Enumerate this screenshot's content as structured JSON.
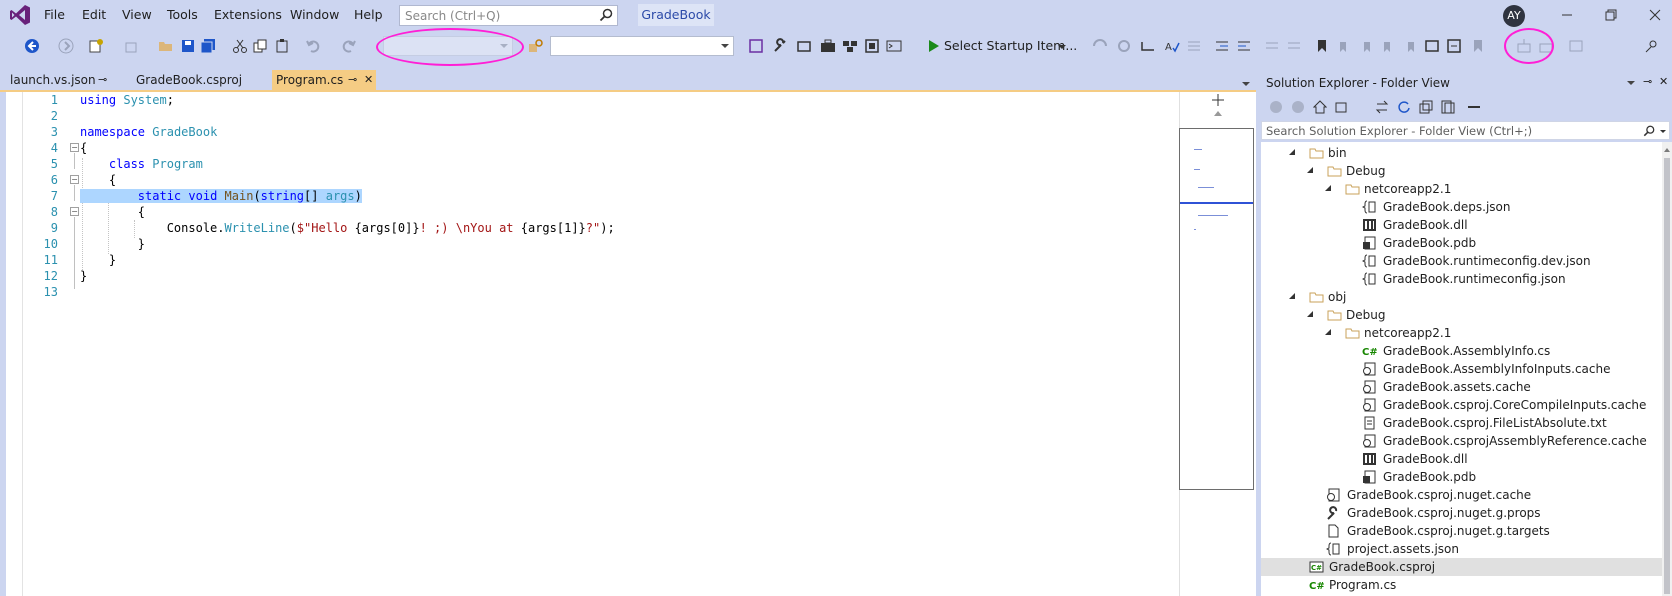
{
  "menu": {
    "items": [
      "File",
      "Edit",
      "View",
      "Tools",
      "Extensions",
      "Window",
      "Help"
    ]
  },
  "search": {
    "placeholder": "Search (Ctrl+Q)"
  },
  "solution_name": "GradeBook",
  "user": {
    "initials": "AY"
  },
  "toolbar": {
    "start_label": "Select Startup Item...",
    "icons": [
      "back-icon",
      "forward-icon",
      "new-item-icon",
      "add-item-icon",
      "open-folder-icon",
      "save-icon",
      "save-all-icon",
      "cut-icon",
      "copy-icon",
      "paste-icon",
      "undo-icon",
      "redo-icon",
      "find-icon",
      "start-icon",
      "bookmark-icon"
    ]
  },
  "tabs": [
    {
      "label": "launch.vs.json",
      "pinned": true,
      "active": false
    },
    {
      "label": "GradeBook.csproj",
      "pinned": false,
      "active": false
    },
    {
      "label": "Program.cs",
      "pinned": true,
      "active": true
    }
  ],
  "editor": {
    "line_numbers": [
      "1",
      "2",
      "3",
      "4",
      "5",
      "6",
      "7",
      "8",
      "9",
      "10",
      "11",
      "12",
      "13"
    ],
    "lines": [
      {
        "kw": "using",
        "rest": " ",
        "ty": "System",
        ";": ";"
      },
      {},
      {
        "kw": "namespace",
        "ty": "GradeBook"
      },
      {
        "text": "{"
      },
      {
        "kw": "class",
        "ty": "Program"
      },
      {
        "text": "{"
      },
      {
        "kw1": "static",
        "kw2": "void",
        "mt": "Main",
        "kw3": "string",
        "ty": "args"
      },
      {
        "text": "{"
      },
      {
        "obj": "Console",
        "mt": "WriteLine",
        "str": "$\"Hello {args[0]}! ;) \\nYou at {args[1]}?\""
      },
      {
        "text": "}"
      },
      {
        "text": "}"
      },
      {
        "text": "}"
      },
      {}
    ],
    "text": {
      "l1_kw": "using",
      "l1_ty": "System",
      "l1_end": ";",
      "l3_kw": "namespace",
      "l3_ty": "GradeBook",
      "brace_open": "{",
      "brace_close": "}",
      "l5_kw": "class",
      "l5_ty": "Program",
      "l7_kw1": "static",
      "l7_kw2": "void",
      "l7_mt": "Main",
      "l7_p1": "(",
      "l7_kw3": "string",
      "l7_p2": "[] ",
      "l7_ty": "args",
      "l7_p3": ")",
      "l9_obj": "Console.",
      "l9_mt": "WriteLine",
      "l9_p1": "(",
      "l9_str1": "$\"Hello ",
      "l9_i1": "{args[0]}",
      "l9_str2": "! ;) ",
      "l9_esc": "\\n",
      "l9_str3": "You at ",
      "l9_i2": "{args[1]}",
      "l9_str4": "?\"",
      "l9_end": ");"
    }
  },
  "solution_explorer": {
    "title": "Solution Explorer - Folder View",
    "search_placeholder": "Search Solution Explorer - Folder View (Ctrl+;)",
    "tree": [
      {
        "label": "bin",
        "type": "folder"
      },
      {
        "label": "Debug",
        "type": "folder"
      },
      {
        "label": "netcoreapp2.1",
        "type": "folder"
      },
      {
        "label": "GradeBook.deps.json",
        "type": "json"
      },
      {
        "label": "GradeBook.dll",
        "type": "dll"
      },
      {
        "label": "GradeBook.pdb",
        "type": "pdb"
      },
      {
        "label": "GradeBook.runtimeconfig.dev.json",
        "type": "json"
      },
      {
        "label": "GradeBook.runtimeconfig.json",
        "type": "json"
      },
      {
        "label": "obj",
        "type": "folder"
      },
      {
        "label": "Debug",
        "type": "folder"
      },
      {
        "label": "netcoreapp2.1",
        "type": "folder"
      },
      {
        "label": "GradeBook.AssemblyInfo.cs",
        "type": "cs"
      },
      {
        "label": "GradeBook.AssemblyInfoInputs.cache",
        "type": "cache"
      },
      {
        "label": "GradeBook.assets.cache",
        "type": "cache"
      },
      {
        "label": "GradeBook.csproj.CoreCompileInputs.cache",
        "type": "cache"
      },
      {
        "label": "GradeBook.csproj.FileListAbsolute.txt",
        "type": "txt"
      },
      {
        "label": "GradeBook.csprojAssemblyReference.cache",
        "type": "cache"
      },
      {
        "label": "GradeBook.dll",
        "type": "dll"
      },
      {
        "label": "GradeBook.pdb",
        "type": "pdb"
      },
      {
        "label": "GradeBook.csproj.nuget.cache",
        "type": "cache"
      },
      {
        "label": "GradeBook.csproj.nuget.g.props",
        "type": "props"
      },
      {
        "label": "GradeBook.csproj.nuget.g.targets",
        "type": "file"
      },
      {
        "label": "project.assets.json",
        "type": "json"
      },
      {
        "label": "GradeBook.csproj",
        "type": "csproj",
        "selected": true
      },
      {
        "label": "Program.cs",
        "type": "cs"
      }
    ]
  },
  "colors": {
    "chrome": "#ccd5f0",
    "active_tab": "#f5cc84",
    "annotation": "#ff1fd6",
    "keyword": "#0000ff",
    "type": "#2b91af",
    "string": "#a31515",
    "selection": "#add6ff"
  }
}
